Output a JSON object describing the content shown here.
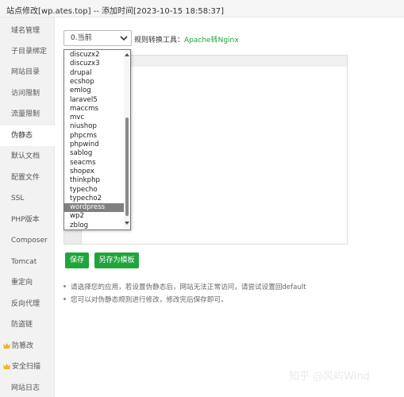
{
  "window": {
    "title": "站点修改[wp.ates.top] -- 添加时间[2023-10-15 18:58:37]"
  },
  "sidebar": {
    "items": [
      {
        "label": "域名管理"
      },
      {
        "label": "子目录绑定"
      },
      {
        "label": "网站目录"
      },
      {
        "label": "访问限制"
      },
      {
        "label": "流量限制"
      },
      {
        "label": "伪静态"
      },
      {
        "label": "默认文档"
      },
      {
        "label": "配置文件"
      },
      {
        "label": "SSL"
      },
      {
        "label": "PHP版本"
      },
      {
        "label": "Composer"
      },
      {
        "label": "Tomcat"
      },
      {
        "label": "重定向"
      },
      {
        "label": "反向代理"
      },
      {
        "label": "防盗链"
      },
      {
        "label": "防篡改"
      },
      {
        "label": "安全扫描"
      },
      {
        "label": "网站日志"
      }
    ],
    "active": "伪静态",
    "accent": "#f0b428"
  },
  "rewrite": {
    "select_value": "0.当前",
    "rule_label": "规则转换工具：",
    "rule_link": "Apache转Nginx",
    "dropdown_options": [
      "discuzx2",
      "discuzx3",
      "drupal",
      "ecshop",
      "emlog",
      "laravel5",
      "maccms",
      "mvc",
      "niushop",
      "phpcms",
      "phpwind",
      "sablog",
      "seacms",
      "shopex",
      "thinkphp",
      "typecho",
      "typecho2",
      "wordpress",
      "wp2",
      "zblog"
    ],
    "highlighted_option": "wordpress"
  },
  "buttons": {
    "save": "保存",
    "save_as_template": "另存为模板"
  },
  "tips": [
    "请选择您的应用，若设置伪静态后，网站无法正常访问，请尝试设置回default",
    "您可以对伪静态规则进行修改，修改完后保存即可。"
  ],
  "watermark": "知乎 @风屿Wind",
  "colors": {
    "accent": "#20a53a",
    "dropdown_highlight": "#808080"
  }
}
